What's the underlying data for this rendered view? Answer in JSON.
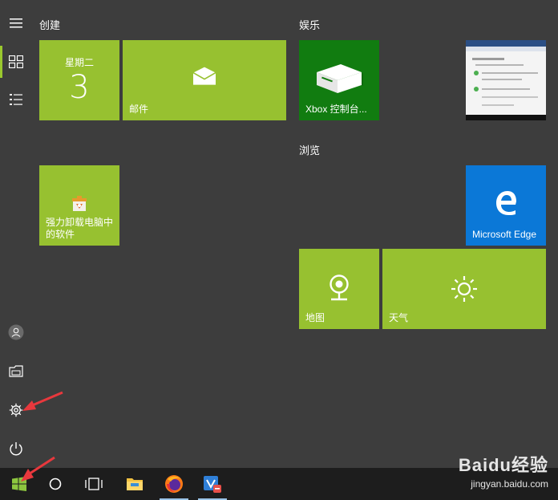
{
  "rail": {
    "items": [
      {
        "name": "hamburger-menu-icon"
      },
      {
        "name": "tiles-view-icon",
        "active": true
      },
      {
        "name": "all-apps-list-icon"
      },
      {
        "name": "user-account-icon"
      },
      {
        "name": "file-explorer-icon"
      },
      {
        "name": "settings-gear-icon"
      },
      {
        "name": "power-icon"
      }
    ]
  },
  "groups": {
    "create": "创建",
    "entertainment": "娱乐",
    "browse": "浏览"
  },
  "tiles": {
    "calendar": {
      "day_name": "星期二",
      "day_number": "3"
    },
    "mail": {
      "label": "邮件"
    },
    "uninstaller": {
      "label": "强力卸载电脑中的软件"
    },
    "xbox": {
      "label": "Xbox 控制台..."
    },
    "edge": {
      "label": "Microsoft Edge"
    },
    "maps": {
      "label": "地图"
    },
    "weather": {
      "label": "天气"
    }
  },
  "colors": {
    "tile_green": "#97c130",
    "xbox_green": "#117c10",
    "edge_blue": "#0b78d7",
    "accent_bar": "#9ac82e",
    "annotation_red": "#e8383d"
  },
  "taskbar": {
    "items": [
      "windows-start-icon",
      "cortana-search-icon",
      "task-view-icon",
      "file-explorer-icon",
      "firefox-icon",
      "vpn-app-icon"
    ]
  },
  "watermark": {
    "brand": "Baidu经验",
    "url": "jingyan.baidu.com"
  }
}
